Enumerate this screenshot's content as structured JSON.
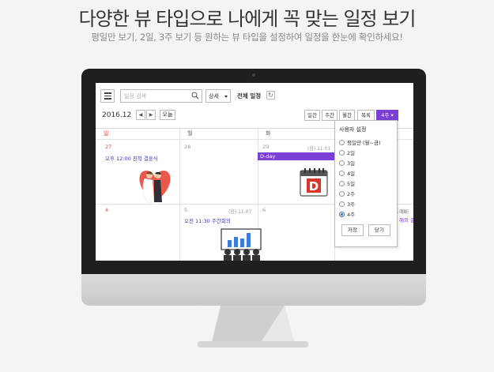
{
  "header": {
    "title": "다양한 뷰 타입으로 나에게 꼭 맞는 일정 보기",
    "subtitle": "평일만 보기, 2일, 3주 보기 등 원하는 뷰 타입을 설정하여 일정을 한눈에 확인하세요!"
  },
  "toolbar": {
    "search_placeholder": "일정 검색",
    "detail_label": "상세",
    "all_schedules": "전체 일정",
    "refresh_glyph": "↻",
    "date": "2016.12",
    "prev": "◀",
    "next": "▶",
    "today": "오늘"
  },
  "view_buttons": [
    "일간",
    "주간",
    "월간",
    "목록",
    "4주 ▾"
  ],
  "day_headers": [
    "일",
    "월",
    "화"
  ],
  "cells": {
    "r1c1_date": "27",
    "r1c2_date": "28",
    "r1c3_date": "29",
    "r1c3_lunar": "(음) 11.01",
    "r2c1_date": "4",
    "r2c2_date": "5",
    "r2c2_lunar": "(음) 11.07",
    "r2c3_date": "6",
    "r2c4_partial_1": "(음) 11.08",
    "r2c4_partial_2": "예배",
    "r2c4_partial_3": "해외 출장"
  },
  "events": {
    "wedding": "오후 12:00 친척 결혼식",
    "dday": "D-day",
    "meeting": "오전 11:30 주간회의",
    "dday_icon_letter": "D"
  },
  "popup": {
    "title": "사용자 설정",
    "options": [
      "평일만 (월~금)",
      "2일",
      "3일",
      "4일",
      "5일",
      "2주",
      "3주",
      "4주"
    ],
    "selected_index": 7,
    "save": "저장",
    "close": "닫기"
  },
  "colors": {
    "accent": "#7a3fd4",
    "sunday_red": "#e0453d",
    "event_text": "#3a3aa8"
  }
}
